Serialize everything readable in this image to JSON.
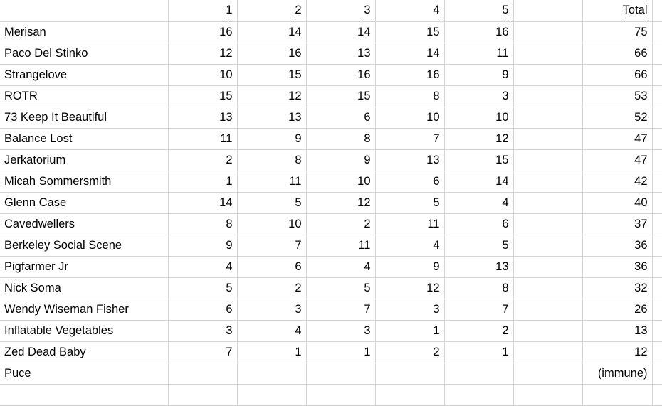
{
  "sheet": {
    "header": {
      "name_label": "",
      "round_labels": [
        "1",
        "2",
        "3",
        "4",
        "5"
      ],
      "gap_label": "",
      "total_label": "Total"
    },
    "rows": [
      {
        "name": "Merisan",
        "scores": [
          "16",
          "14",
          "14",
          "15",
          "16"
        ],
        "gap": "",
        "total": "75"
      },
      {
        "name": "Paco Del Stinko",
        "scores": [
          "12",
          "16",
          "13",
          "14",
          "11"
        ],
        "gap": "",
        "total": "66"
      },
      {
        "name": "Strangelove",
        "scores": [
          "10",
          "15",
          "16",
          "16",
          "9"
        ],
        "gap": "",
        "total": "66"
      },
      {
        "name": "ROTR",
        "scores": [
          "15",
          "12",
          "15",
          "8",
          "3"
        ],
        "gap": "",
        "total": "53"
      },
      {
        "name": "73 Keep It Beautiful",
        "scores": [
          "13",
          "13",
          "6",
          "10",
          "10"
        ],
        "gap": "",
        "total": "52"
      },
      {
        "name": "Balance Lost",
        "scores": [
          "11",
          "9",
          "8",
          "7",
          "12"
        ],
        "gap": "",
        "total": "47"
      },
      {
        "name": "Jerkatorium",
        "scores": [
          "2",
          "8",
          "9",
          "13",
          "15"
        ],
        "gap": "",
        "total": "47"
      },
      {
        "name": "Micah Sommersmith",
        "scores": [
          "1",
          "11",
          "10",
          "6",
          "14"
        ],
        "gap": "",
        "total": "42"
      },
      {
        "name": "Glenn Case",
        "scores": [
          "14",
          "5",
          "12",
          "5",
          "4"
        ],
        "gap": "",
        "total": "40"
      },
      {
        "name": "Cavedwellers",
        "scores": [
          "8",
          "10",
          "2",
          "11",
          "6"
        ],
        "gap": "",
        "total": "37"
      },
      {
        "name": "Berkeley Social Scene",
        "scores": [
          "9",
          "7",
          "11",
          "4",
          "5"
        ],
        "gap": "",
        "total": "36"
      },
      {
        "name": "Pigfarmer Jr",
        "scores": [
          "4",
          "6",
          "4",
          "9",
          "13"
        ],
        "gap": "",
        "total": "36"
      },
      {
        "name": "Nick Soma",
        "scores": [
          "5",
          "2",
          "5",
          "12",
          "8"
        ],
        "gap": "",
        "total": "32"
      },
      {
        "name": "Wendy Wiseman Fisher",
        "scores": [
          "6",
          "3",
          "7",
          "3",
          "7"
        ],
        "gap": "",
        "total": "26"
      },
      {
        "name": "Inflatable Vegetables",
        "scores": [
          "3",
          "4",
          "3",
          "1",
          "2"
        ],
        "gap": "",
        "total": "13"
      },
      {
        "name": "Zed Dead Baby",
        "scores": [
          "7",
          "1",
          "1",
          "2",
          "1"
        ],
        "gap": "",
        "total": "12"
      },
      {
        "name": "Puce",
        "scores": [
          "",
          "",
          "",
          "",
          ""
        ],
        "gap": "",
        "total": "(immune)"
      },
      {
        "name": "",
        "scores": [
          "",
          "",
          "",
          "",
          ""
        ],
        "gap": "",
        "total": ""
      }
    ],
    "colors": {
      "gridline": "#d4d4d4",
      "text": "#000000",
      "background": "#ffffff"
    }
  }
}
